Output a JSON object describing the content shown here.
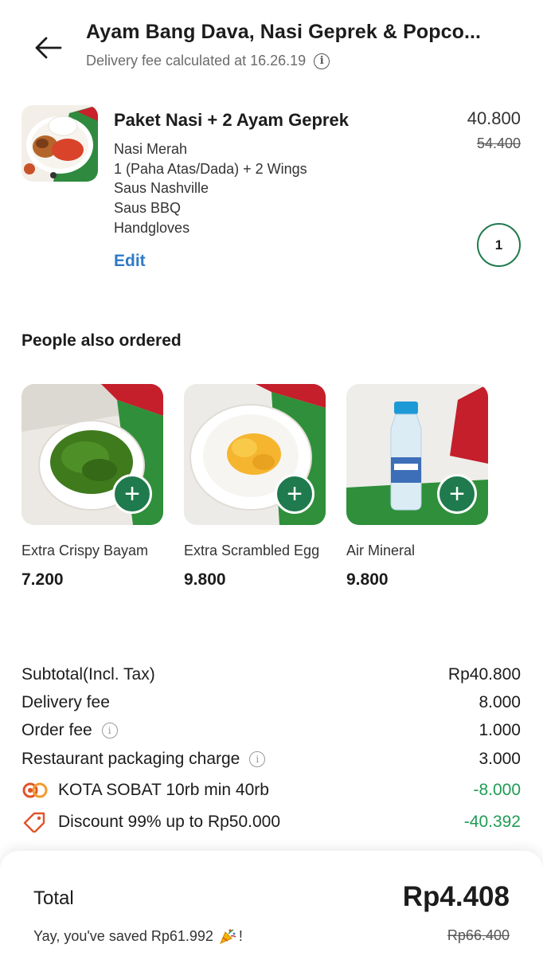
{
  "header": {
    "title": "Ayam Bang Dava, Nasi Geprek & Popco...",
    "subtitle": "Delivery fee calculated at 16.26.19"
  },
  "cart_item": {
    "name": "Paket Nasi + 2 Ayam Geprek",
    "options": [
      "Nasi Merah",
      "1 (Paha Atas/Dada) + 2 Wings",
      "Saus Nashville",
      "Saus BBQ",
      "Handgloves"
    ],
    "edit_label": "Edit",
    "price": "40.800",
    "original_price": "54.400",
    "quantity": "1"
  },
  "recommendations": {
    "title": "People also ordered",
    "items": [
      {
        "name": "Extra Crispy Bayam",
        "price": "7.200",
        "add_label": "+"
      },
      {
        "name": "Extra Scrambled Egg",
        "price": "9.800",
        "add_label": "+"
      },
      {
        "name": "Air Mineral",
        "price": "9.800",
        "add_label": "+"
      }
    ]
  },
  "bill": {
    "subtotal": {
      "label": "Subtotal(Incl. Tax)",
      "value": "Rp40.800"
    },
    "delivery": {
      "label": "Delivery fee",
      "value": "8.000"
    },
    "order_fee": {
      "label": "Order fee",
      "value": "1.000"
    },
    "packaging": {
      "label": "Restaurant packaging charge",
      "value": "3.000"
    },
    "promo": {
      "label": "KOTA SOBAT 10rb min 40rb",
      "value": "-8.000"
    },
    "discount": {
      "label": "Discount 99% up to Rp50.000",
      "value": "-40.392"
    }
  },
  "footer": {
    "total_label": "Total",
    "total_value": "Rp4.408",
    "saved_text": "Yay, you've saved Rp61.992",
    "saved_suffix": "!",
    "original_total": "Rp66.400"
  },
  "colors": {
    "accent_green": "#1f7a4d",
    "discount_green": "#1f9c55",
    "link_blue": "#2e7bc4"
  },
  "icons": [
    "back-arrow-icon",
    "info-icon",
    "plus-icon",
    "coupon-icon",
    "discount-tag-icon",
    "party-popper-icon"
  ]
}
